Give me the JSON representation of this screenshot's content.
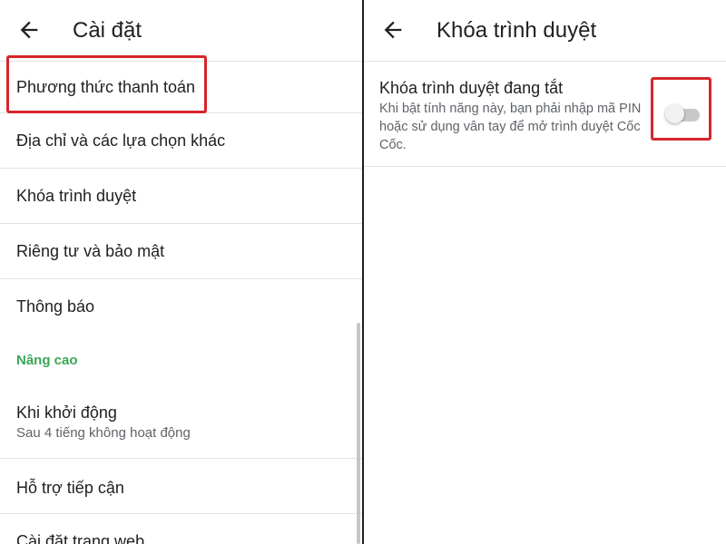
{
  "left": {
    "title": "Cài đặt",
    "items": [
      {
        "label": "Phương thức thanh toán"
      },
      {
        "label": "Địa chỉ và các lựa chọn khác"
      },
      {
        "label": "Khóa trình duyệt"
      },
      {
        "label": "Riêng tư và bảo mật"
      },
      {
        "label": "Thông báo"
      }
    ],
    "section_header": "Nâng cao",
    "advanced_items": [
      {
        "label": "Khi khởi động",
        "sub": "Sau 4 tiếng không hoạt động"
      },
      {
        "label": "Hỗ trợ tiếp cận"
      },
      {
        "label": "Cài đặt trang web"
      }
    ]
  },
  "right": {
    "title": "Khóa trình duyệt",
    "setting": {
      "title": "Khóa trình duyệt đang tắt",
      "description": "Khi bật tính năng này, bạn phải nhập mã PIN hoặc sử dụng vân tay để mở trình duyệt Cốc Cốc.",
      "enabled": false
    }
  },
  "colors": {
    "accent_green": "#3aa757",
    "highlight_red": "#d6252b",
    "text_primary": "#202124",
    "text_secondary": "#5f6368"
  },
  "icons": [
    "arrow-left-icon"
  ]
}
